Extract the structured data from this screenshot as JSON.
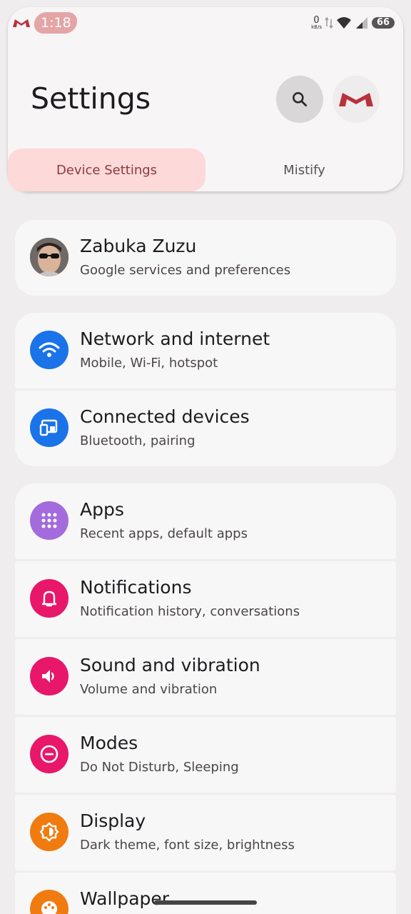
{
  "status_bar": {
    "time": "1:18",
    "net_speed_value": "0",
    "net_speed_unit": "kB/s",
    "battery": "66"
  },
  "header": {
    "title": "Settings",
    "tabs": [
      {
        "label": "Device Settings",
        "active": true
      },
      {
        "label": "Mistify",
        "active": false
      }
    ]
  },
  "account": {
    "name": "Zabuka Zuzu",
    "subtitle": "Google services and preferences"
  },
  "items": [
    {
      "title": "Network and internet",
      "subtitle": "Mobile, Wi-Fi, hotspot",
      "icon": "wifi-icon",
      "color": "#1a73e8"
    },
    {
      "title": "Connected devices",
      "subtitle": "Bluetooth, pairing",
      "icon": "devices-icon",
      "color": "#1a73e8"
    },
    {
      "title": "Apps",
      "subtitle": "Recent apps, default apps",
      "icon": "apps-grid-icon",
      "color": "#a46bdc"
    },
    {
      "title": "Notifications",
      "subtitle": "Notification history, conversations",
      "icon": "bell-icon",
      "color": "#e8176a"
    },
    {
      "title": "Sound and vibration",
      "subtitle": "Volume and vibration",
      "icon": "speaker-icon",
      "color": "#e8176a"
    },
    {
      "title": "Modes",
      "subtitle": "Do Not Disturb, Sleeping",
      "icon": "do-not-disturb-icon",
      "color": "#e8176a"
    },
    {
      "title": "Display",
      "subtitle": "Dark theme, font size, brightness",
      "icon": "brightness-icon",
      "color": "#f07b10"
    },
    {
      "title": "Wallpaper",
      "subtitle": "",
      "icon": "palette-icon",
      "color": "#f07b10"
    }
  ],
  "colors": {
    "accent_tab": "#fdd9d9",
    "brand": "#b8323c"
  }
}
